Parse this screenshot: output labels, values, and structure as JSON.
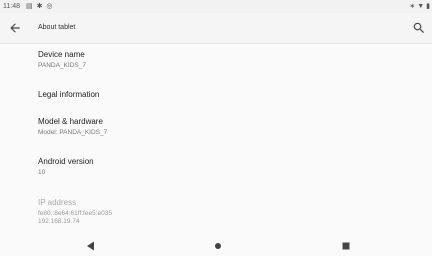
{
  "status_bar": {
    "time": "11:48",
    "left_icons": [
      "notification-icon",
      "settings-icon",
      "sync-icon"
    ],
    "right_icons": [
      "bluetooth-icon",
      "wifi-icon",
      "battery-icon"
    ]
  },
  "app_bar": {
    "title": "About tablet",
    "back_icon": "arrow-back-icon",
    "search_icon": "search-icon"
  },
  "items": [
    {
      "label": "Device name",
      "value": "PANDA_KIDS_7"
    },
    {
      "label": "Legal information"
    },
    {
      "label": "Model & hardware",
      "value": "Model: PANDA_KIDS_7"
    },
    {
      "label": "Android version",
      "value": "10"
    },
    {
      "label": "IP address",
      "value": "fe80::8e64:61ff:fee5:e035",
      "value2": "192.168.19.74"
    }
  ],
  "nav_bar": {
    "back": "nav-back-icon",
    "home": "nav-home-icon",
    "recents": "nav-recents-icon"
  }
}
